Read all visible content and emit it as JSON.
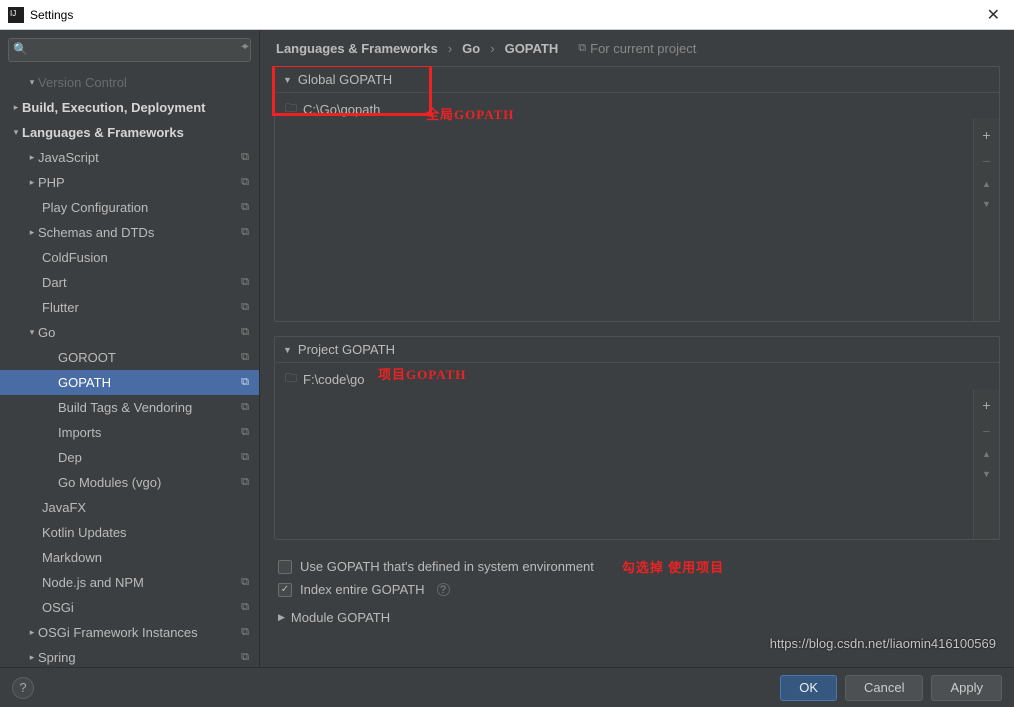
{
  "window": {
    "title": "Settings"
  },
  "search": {
    "placeholder": ""
  },
  "sidebar": {
    "top_label": "Version Control",
    "items": [
      {
        "label": "Build, Execution, Deployment"
      },
      {
        "label": "Languages & Frameworks"
      },
      {
        "label": "JavaScript"
      },
      {
        "label": "PHP"
      },
      {
        "label": "Play Configuration"
      },
      {
        "label": "Schemas and DTDs"
      },
      {
        "label": "ColdFusion"
      },
      {
        "label": "Dart"
      },
      {
        "label": "Flutter"
      },
      {
        "label": "Go"
      },
      {
        "label": "GOROOT"
      },
      {
        "label": "GOPATH"
      },
      {
        "label": "Build Tags & Vendoring"
      },
      {
        "label": "Imports"
      },
      {
        "label": "Dep"
      },
      {
        "label": "Go Modules (vgo)"
      },
      {
        "label": "JavaFX"
      },
      {
        "label": "Kotlin Updates"
      },
      {
        "label": "Markdown"
      },
      {
        "label": "Node.js and NPM"
      },
      {
        "label": "OSGi"
      },
      {
        "label": "OSGi Framework Instances"
      },
      {
        "label": "Spring"
      }
    ]
  },
  "breadcrumb": {
    "a": "Languages & Frameworks",
    "b": "Go",
    "c": "GOPATH",
    "project_hint": "For current project"
  },
  "groups": {
    "global": {
      "title": "Global GOPATH",
      "path": "C:\\Go\\gopath"
    },
    "project": {
      "title": "Project GOPATH",
      "path": "F:\\code\\go"
    },
    "module": {
      "title": "Module GOPATH"
    }
  },
  "checks": {
    "system": "Use GOPATH that's defined in system environment",
    "index": "Index entire GOPATH"
  },
  "annotations": {
    "global": "全局GOPATH",
    "project": "项目GOPATH",
    "check": "勾选掉  使用项目"
  },
  "footer": {
    "ok": "OK",
    "cancel": "Cancel",
    "apply": "Apply"
  },
  "watermark": "https://blog.csdn.net/liaomin416100569"
}
